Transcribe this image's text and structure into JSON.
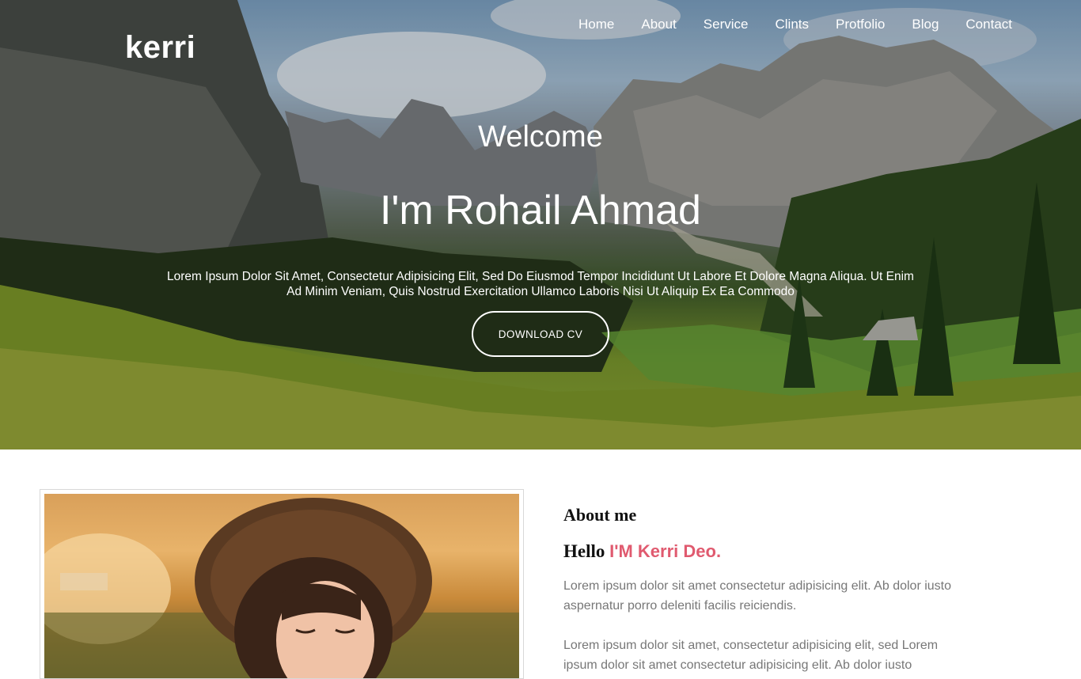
{
  "header": {
    "logo": "kerri",
    "nav": [
      "Home",
      "About",
      "Service",
      "Clints",
      "Protfolio",
      "Blog",
      "Contact"
    ]
  },
  "hero": {
    "welcome": "Welcome",
    "name": "I'm Rohail Ahmad",
    "description": "Lorem Ipsum Dolor Sit Amet, Consectetur Adipisicing Elit, Sed Do Eiusmod Tempor Incididunt Ut Labore Et Dolore Magna Aliqua. Ut Enim Ad Minim Veniam, Quis Nostrud Exercitation Ullamco Laboris Nisi Ut Aliquip Ex Ea Commodo",
    "cv_button": "DOWNLOAD CV"
  },
  "about": {
    "title": "About me",
    "hello": "Hello",
    "highlight": "I'M Kerri Deo.",
    "paragraph_1": "Lorem ipsum dolor sit amet consectetur adipisicing elit. Ab dolor iusto aspernatur porro deleniti facilis reiciendis.",
    "paragraph_2": "Lorem ipsum dolor sit amet, consectetur adipisicing elit, sed Lorem ipsum dolor sit amet consectetur adipisicing elit. Ab dolor iusto"
  },
  "colors": {
    "accent": "#e05a6f",
    "body_text": "#777777"
  }
}
